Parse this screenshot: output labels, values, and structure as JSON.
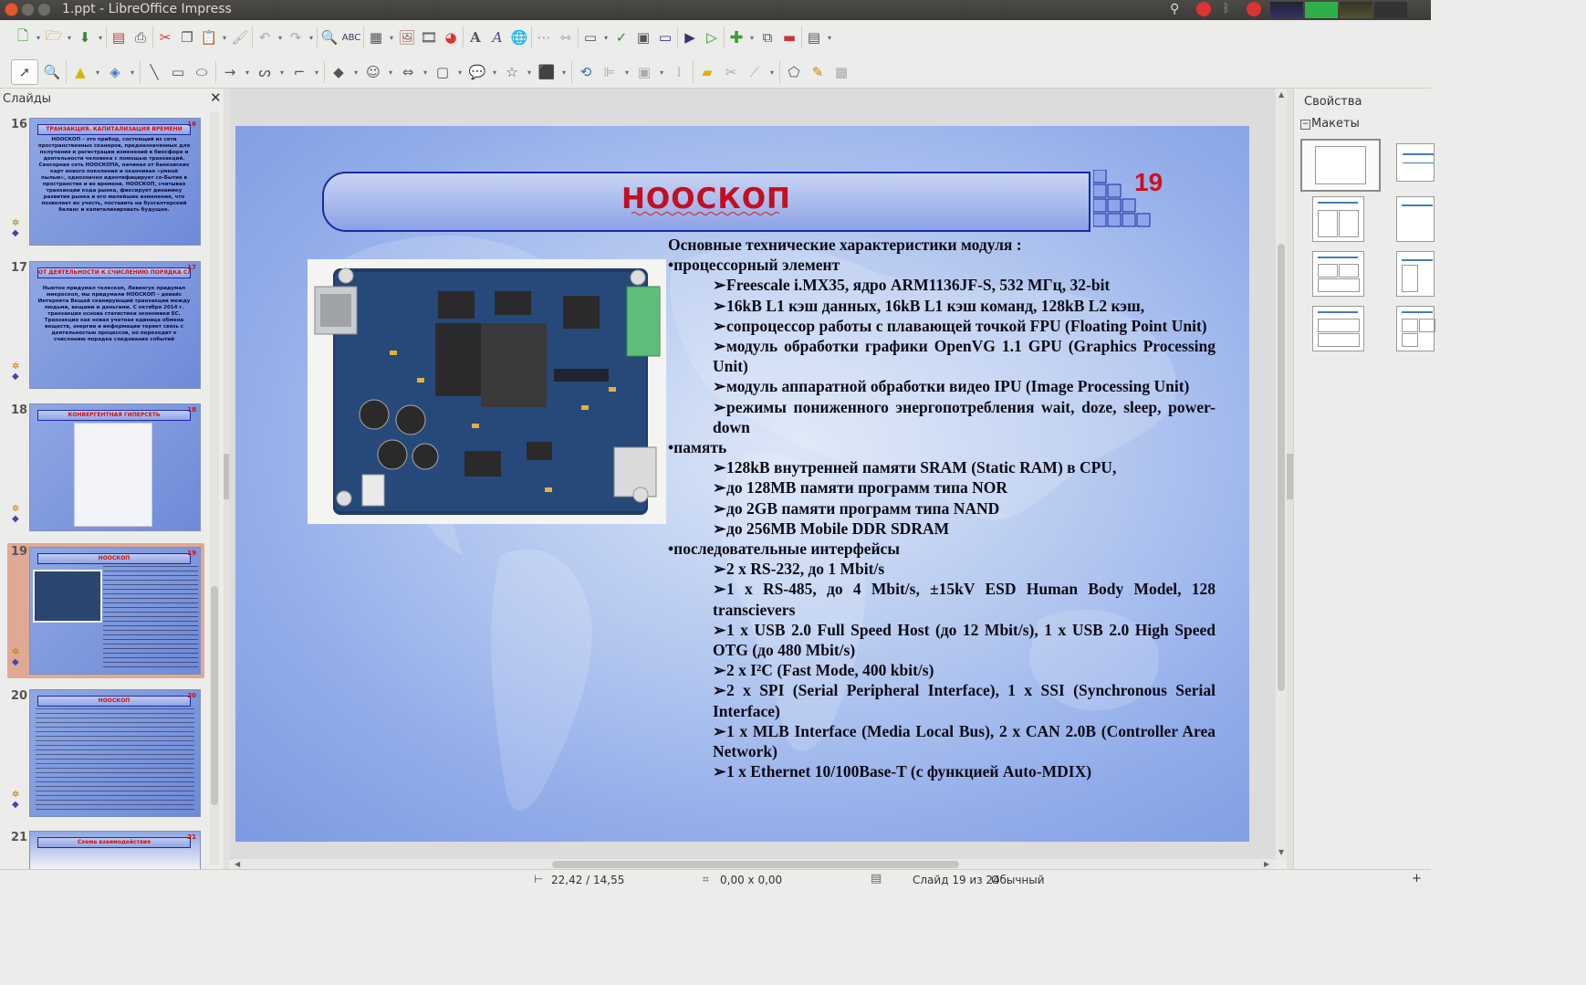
{
  "window": {
    "title": "1.ppt - LibreOffice Impress"
  },
  "slides_pane": {
    "title": "Слайды",
    "items": [
      {
        "num": "16",
        "thumb_title": "ТРАНЗАКЦИЯ. КАПИТАЛИЗАЦИЯ ВРЕМЕНИ",
        "thumb_num": "16",
        "thumb_text": "НООСКОП – это прибор, состоящий из сети пространственных сканеров, предназначенных для получения и регистрации изменений в биосфере и деятельности человека с помощью транзакций. Сенсорная сеть НООСКОПА, начиная от банковских карт нового поколения и оканчивая «умной пылью», однозначно идентифицирует со-Бытия в пространстве и во времени. НООСКОП, считывая транзакции кода рынка, фиксирует динамику развития рынка и его малейшие изменения, что позволяет их учесть, поставить на бухгалтерский баланс и капитализировать будущее."
      },
      {
        "num": "17",
        "thumb_title": "ОТ ДЕЯТЕЛЬНОСТИ К СЧИСЛЕНИЮ ПОРЯДКА СЛЕДОВАНИЯ СОБЫТИЙ",
        "thumb_num": "17",
        "thumb_text": "Ньютон придумал телескоп, Левенгук придумал микроскоп, мы придумали НООСКОП – девайс Интернета Вещей сканирующий транзакции между людьми, вещами и деньгами. С октября 2014 г. транзакция основа статистики экономики ЕС. Транзакция как новая учетная единица обмена веществ, энергии и информации теряет связь с деятельностью процессов, но переходит к счислению порядка следования событий"
      },
      {
        "num": "18",
        "thumb_title": "КОНВЕРГЕНТНАЯ ГИПЕРСЕТЬ",
        "thumb_num": "18",
        "thumb_text": ""
      },
      {
        "num": "19",
        "thumb_title": "НООСКОП",
        "thumb_num": "19",
        "thumb_text": ""
      },
      {
        "num": "20",
        "thumb_title": "НООСКОП",
        "thumb_num": "20",
        "thumb_text": ""
      },
      {
        "num": "21",
        "thumb_title": "Схема взаимодействия",
        "thumb_num": "21",
        "thumb_text": ""
      }
    ]
  },
  "slide": {
    "title": "НООСКОП",
    "number": "19",
    "intro": "Основные технические характеристики модуля :",
    "sections": [
      {
        "heading": "процессорный элемент",
        "items": [
          "Freescale i.MX35, ядро ARM1136JF-S, 532 МГц, 32-bit",
          "16kB L1 кэш данных, 16kB L1 кэш команд, 128kB L2 кэш,",
          "сопроцессор работы с плавающей точкой FPU (Floating Point Unit)",
          "модуль обработки графики OpenVG 1.1 GPU (Graphics Processing Unit)",
          "модуль аппаратной обработки видео IPU (Image Processing Unit)",
          "режимы пониженного энергопотребления wait, doze, sleep, power-down"
        ]
      },
      {
        "heading": "память",
        "items": [
          "128kB внутренней памяти SRAM (Static RAM) в CPU,",
          "до 128MB памяти программ типа NOR",
          "до 2GB памяти программ типа NAND",
          "до 256MB Mobile DDR SDRAM"
        ]
      },
      {
        "heading": "последовательные интерфейсы",
        "items": [
          "2 x RS-232, до 1 Mbit/s",
          "1 x RS-485, до 4 Mbit/s, ±15kV ESD Human Body Model, 128 transcievers",
          "1 x USB 2.0 Full Speed Host (до 12 Mbit/s), 1 x USB 2.0 High Speed OTG (до 480 Mbit/s)",
          "2 x I²C (Fast Mode, 400 kbit/s)",
          "2 x SPI (Serial Peripheral Interface), 1 x SSI (Synchronous Serial Interface)",
          "1 x MLB Interface (Media Local Bus), 2 x CAN 2.0B (Controller Area Network)",
          "1 x Ethernet 10/100Base-T (с функцией Auto-MDIX)"
        ]
      }
    ]
  },
  "properties_pane": {
    "title": "Свойства",
    "layouts_label": "Макеты"
  },
  "statusbar": {
    "position": "22,42 / 14,55",
    "size": "0,00 x 0,00",
    "slide_info": "Слайд 19 из 24",
    "master": "Обычный"
  },
  "colors": {
    "title_red": "#c40e22",
    "selection": "#e0a994",
    "slide_blue": "#93adea"
  }
}
